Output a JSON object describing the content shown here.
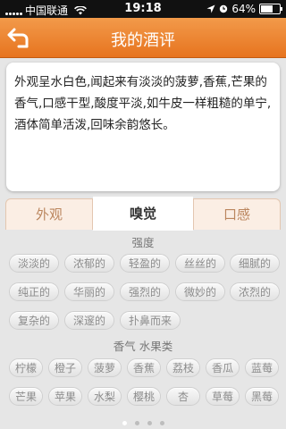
{
  "status_bar": {
    "carrier": "中国联通",
    "time": "19:18",
    "battery": "64%",
    "battery_level": 0.64
  },
  "header": {
    "title": "我的酒评"
  },
  "description": "外观呈水白色,闻起来有淡淡的菠萝,香蕉,芒果的香气,口感干型,酸度平淡,如牛皮一样粗糙的单宁,酒体简单活泼,回味余韵悠长。",
  "tabs": [
    {
      "label": "外观",
      "active": false
    },
    {
      "label": "嗅觉",
      "active": true
    },
    {
      "label": "口感",
      "active": false
    }
  ],
  "sections": [
    {
      "heading": "强度",
      "tags": [
        "淡淡的",
        "浓郁的",
        "轻盈的",
        "丝丝的",
        "细腻的",
        "纯正的",
        "华丽的",
        "强烈的",
        "微妙的",
        "浓烈的",
        "复杂的",
        "深邃的",
        "扑鼻而来"
      ]
    },
    {
      "heading": "香气 水果类",
      "tags": [
        "柠檬",
        "橙子",
        "菠萝",
        "香蕉",
        "荔枝",
        "香瓜",
        "蓝莓",
        "芒果",
        "苹果",
        "水梨",
        "樱桃",
        "杏",
        "草莓",
        "黑莓"
      ]
    }
  ],
  "pager": {
    "count": 4,
    "current": 0
  },
  "colors": {
    "nav_bar": "#e7741f",
    "active_tab_text": "#333333",
    "inactive_tab_text": "#bb865e",
    "tag_text": "#8c8c8c"
  }
}
